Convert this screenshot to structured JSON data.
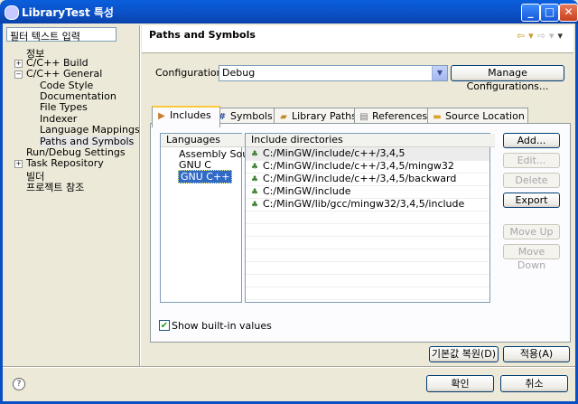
{
  "window": {
    "title": "LibraryTest 특성",
    "minimize": "_",
    "maximize": "□",
    "close": "✕"
  },
  "left": {
    "filter_placeholder": "필터 텍스트 입력",
    "tree": [
      {
        "label": "정보"
      },
      {
        "label": "C/C++ Build",
        "expander": "+"
      },
      {
        "label": "C/C++ General",
        "expander": "−"
      },
      {
        "label": "Code Style"
      },
      {
        "label": "Documentation"
      },
      {
        "label": "File Types"
      },
      {
        "label": "Indexer"
      },
      {
        "label": "Language Mappings"
      },
      {
        "label": "Paths and Symbols",
        "selected": true
      },
      {
        "label": "Run/Debug Settings"
      },
      {
        "label": "Task Repository",
        "expander": "+"
      },
      {
        "label": "빌더"
      },
      {
        "label": "프로젝트 참조"
      }
    ]
  },
  "header": {
    "title": "Paths and Symbols",
    "nav_icons": [
      "back-arrow-icon",
      "forward-arrow-icon",
      "view-menu-icon"
    ]
  },
  "config": {
    "label": "Configuration:",
    "value": "Debug",
    "manage_label": "Manage Configurations..."
  },
  "tabs": [
    {
      "label": "Includes",
      "icon": "includes-icon",
      "active": true
    },
    {
      "label": "Symbols",
      "icon": "hash-icon"
    },
    {
      "label": "Library Paths",
      "icon": "library-icon"
    },
    {
      "label": "References",
      "icon": "references-icon"
    },
    {
      "label": "Source Location",
      "icon": "folder-icon"
    }
  ],
  "languages": {
    "header": "Languages",
    "items": [
      "Assembly Sou",
      "GNU C",
      "GNU C++"
    ],
    "selected_index": 2
  },
  "includes": {
    "header": "Include directories",
    "items": [
      "C:/MinGW/include/c++/3,4,5",
      "C:/MinGW/include/c++/3,4,5/mingw32",
      "C:/MinGW/include/c++/3,4,5/backward",
      "C:/MinGW/include",
      "C:/MinGW/lib/gcc/mingw32/3,4,5/include"
    ]
  },
  "side_buttons": {
    "add": "Add...",
    "edit": "Edit...",
    "delete": "Delete",
    "export": "Export",
    "move_up": "Move Up",
    "move_down": "Move Down"
  },
  "show_builtin": {
    "label": "Show built-in values",
    "checked": true
  },
  "footer": {
    "restore": "기본값 복원(D)",
    "apply": "적용(A)",
    "ok": "확인",
    "cancel": "취소",
    "help": "?"
  },
  "colors": {
    "titlebar": "#0b4fc4",
    "selection": "#316ac5",
    "tab_highlight": "#ffc73c"
  }
}
